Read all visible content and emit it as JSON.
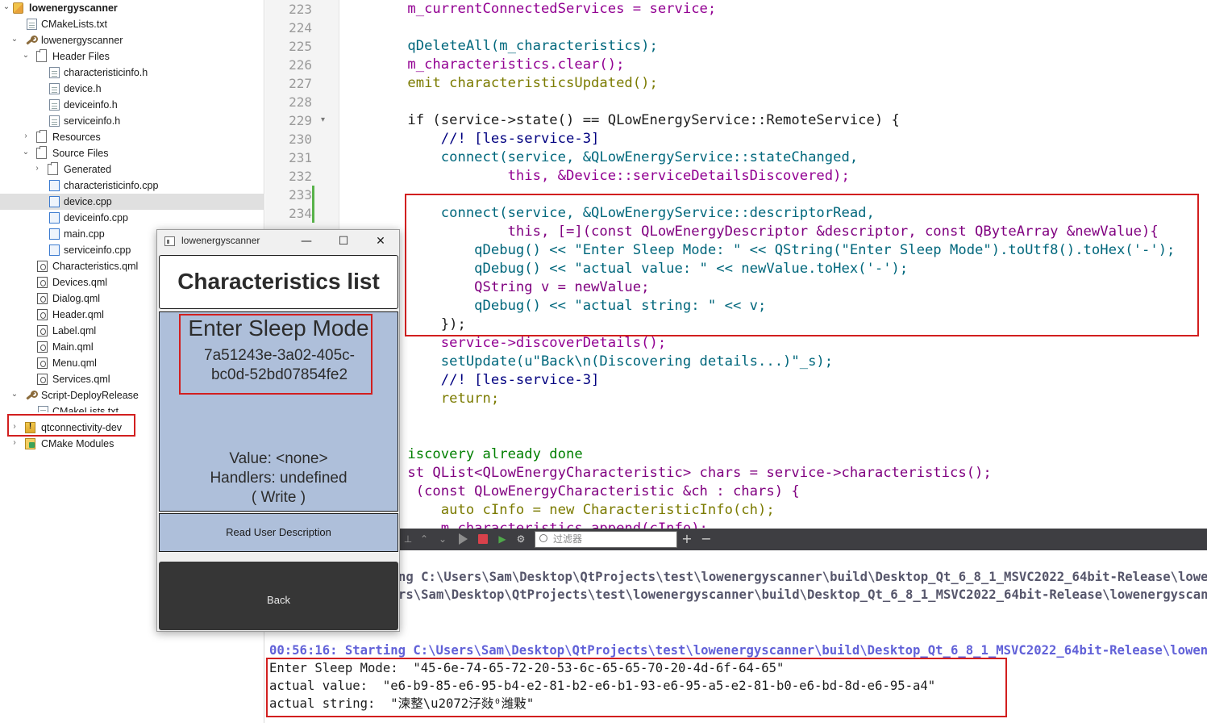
{
  "project_tree": {
    "items": [
      {
        "label": "lowenergyscanner",
        "icon": "project-icon"
      },
      {
        "label": "CMakeLists.txt",
        "icon": "cmake-file-icon"
      },
      {
        "label": "lowenergyscanner",
        "icon": "build-target-icon"
      },
      {
        "label": "Header Files",
        "icon": "folder-icon"
      },
      {
        "label": "characteristicinfo.h",
        "icon": "header-file-icon"
      },
      {
        "label": "device.h",
        "icon": "header-file-icon"
      },
      {
        "label": "deviceinfo.h",
        "icon": "header-file-icon"
      },
      {
        "label": "serviceinfo.h",
        "icon": "header-file-icon"
      },
      {
        "label": "Resources",
        "icon": "folder-icon"
      },
      {
        "label": "Source Files",
        "icon": "folder-icon"
      },
      {
        "label": "Generated",
        "icon": "folder-icon"
      },
      {
        "label": "characteristicinfo.cpp",
        "icon": "cpp-file-icon"
      },
      {
        "label": "device.cpp",
        "icon": "cpp-file-icon"
      },
      {
        "label": "deviceinfo.cpp",
        "icon": "cpp-file-icon"
      },
      {
        "label": "main.cpp",
        "icon": "cpp-file-icon"
      },
      {
        "label": "serviceinfo.cpp",
        "icon": "cpp-file-icon"
      },
      {
        "label": "Characteristics.qml",
        "icon": "qml-file-icon"
      },
      {
        "label": "Devices.qml",
        "icon": "qml-file-icon"
      },
      {
        "label": "Dialog.qml",
        "icon": "qml-file-icon"
      },
      {
        "label": "Header.qml",
        "icon": "qml-file-icon"
      },
      {
        "label": "Label.qml",
        "icon": "qml-file-icon"
      },
      {
        "label": "Main.qml",
        "icon": "qml-file-icon"
      },
      {
        "label": "Menu.qml",
        "icon": "qml-file-icon"
      },
      {
        "label": "Services.qml",
        "icon": "qml-file-icon"
      },
      {
        "label": "Script-DeployRelease",
        "icon": "build-target-icon"
      },
      {
        "label": "CMakeLists.txt",
        "icon": "cmake-file-icon"
      },
      {
        "label": "qtconnectivity-dev",
        "icon": "warning-project-icon"
      },
      {
        "label": "CMake Modules",
        "icon": "cmake-modules-icon"
      }
    ]
  },
  "editor": {
    "line_numbers": [
      "223",
      "224",
      "225",
      "226",
      "227",
      "228",
      "229",
      "230",
      "231",
      "232",
      "233",
      "234"
    ],
    "lines": [
      "    m_currentConnectedServices = service;",
      "",
      "    qDeleteAll(m_characteristics);",
      "    m_characteristics.clear();",
      "    emit characteristicsUpdated();",
      "",
      "    if (service->state() == QLowEnergyService::RemoteService) {",
      "        //! [les-service-3]",
      "        connect(service, &QLowEnergyService::stateChanged,",
      "                this, &Device::serviceDetailsDiscovered);",
      "",
      "        connect(service, &QLowEnergyService::descriptorRead,",
      "                this, [=](const QLowEnergyDescriptor &descriptor, const QByteArray &newValue){",
      "            qDebug() << \"Enter Sleep Mode: \" << QString(\"Enter Sleep Mode\").toUtf8().toHex('-');",
      "            qDebug() << \"actual value: \" << newValue.toHex('-');",
      "            QString v = newValue;",
      "            qDebug() << \"actual string: \" << v;",
      "        });",
      "        service->discoverDetails();",
      "        setUpdate(u\"Back\\n(Discovering details...)\"_s);",
      "        //! [les-service-3]",
      "        return;",
      "",
      "",
      "    iscovery already done",
      "    st QList<QLowEnergyCharacteristic> chars = service->characteristics();",
      "     (const QLowEnergyCharacteristic &ch : chars) {",
      "        auto cInfo = new CharacteristicInfo(ch);",
      "        m_characteristics.append(cInfo);"
    ]
  },
  "output": {
    "filter_placeholder": "过滤器",
    "lines": [
      "ng C:\\Users\\Sam\\Desktop\\QtProjects\\test\\lowenergyscanner\\build\\Desktop_Qt_6_8_1_MSVC2022_64bit-Release\\lowenergyscanner.exe",
      "rs\\Sam\\Desktop\\QtProjects\\test\\lowenergyscanner\\build\\Desktop_Qt_6_8_1_MSVC2022_64bit-Release\\lowenergyscanner.exe",
      "",
      "",
      "00:56:16: Starting C:\\Users\\Sam\\Desktop\\QtProjects\\test\\lowenergyscanner\\build\\Desktop_Qt_6_8_1_MSVC2022_64bit-Release\\lowenergyscanner.exe...",
      "Enter Sleep Mode:  \"45-6e-74-65-72-20-53-6c-65-65-70-20-4d-6f-64-65\"",
      "actual value:  \"e6-b9-85-e6-95-b4-e2-81-b2-e6-b1-93-e6-95-a5-e2-81-b0-e6-bd-8d-e6-95-a4\"",
      "actual string:  \"湅整\\u2072汓敥⁰潍敤\""
    ]
  },
  "app_window": {
    "title": "lowenergyscanner",
    "minimize_glyph": "—",
    "maximize_glyph": "☐",
    "close_glyph": "✕",
    "header_title": "Characteristics list",
    "characteristic": {
      "name": "Enter Sleep Mode",
      "uuid_line1": "7a51243e-3a02-405c-",
      "uuid_line2": "bc0d-52bd07854fe2",
      "value_line": "Value: <none>",
      "handlers_line": "Handlers: undefined",
      "write_line": "(  Write )"
    },
    "read_user_description_button": "Read User Description",
    "back_button": "Back"
  },
  "highlight_color": "#d21f1f"
}
